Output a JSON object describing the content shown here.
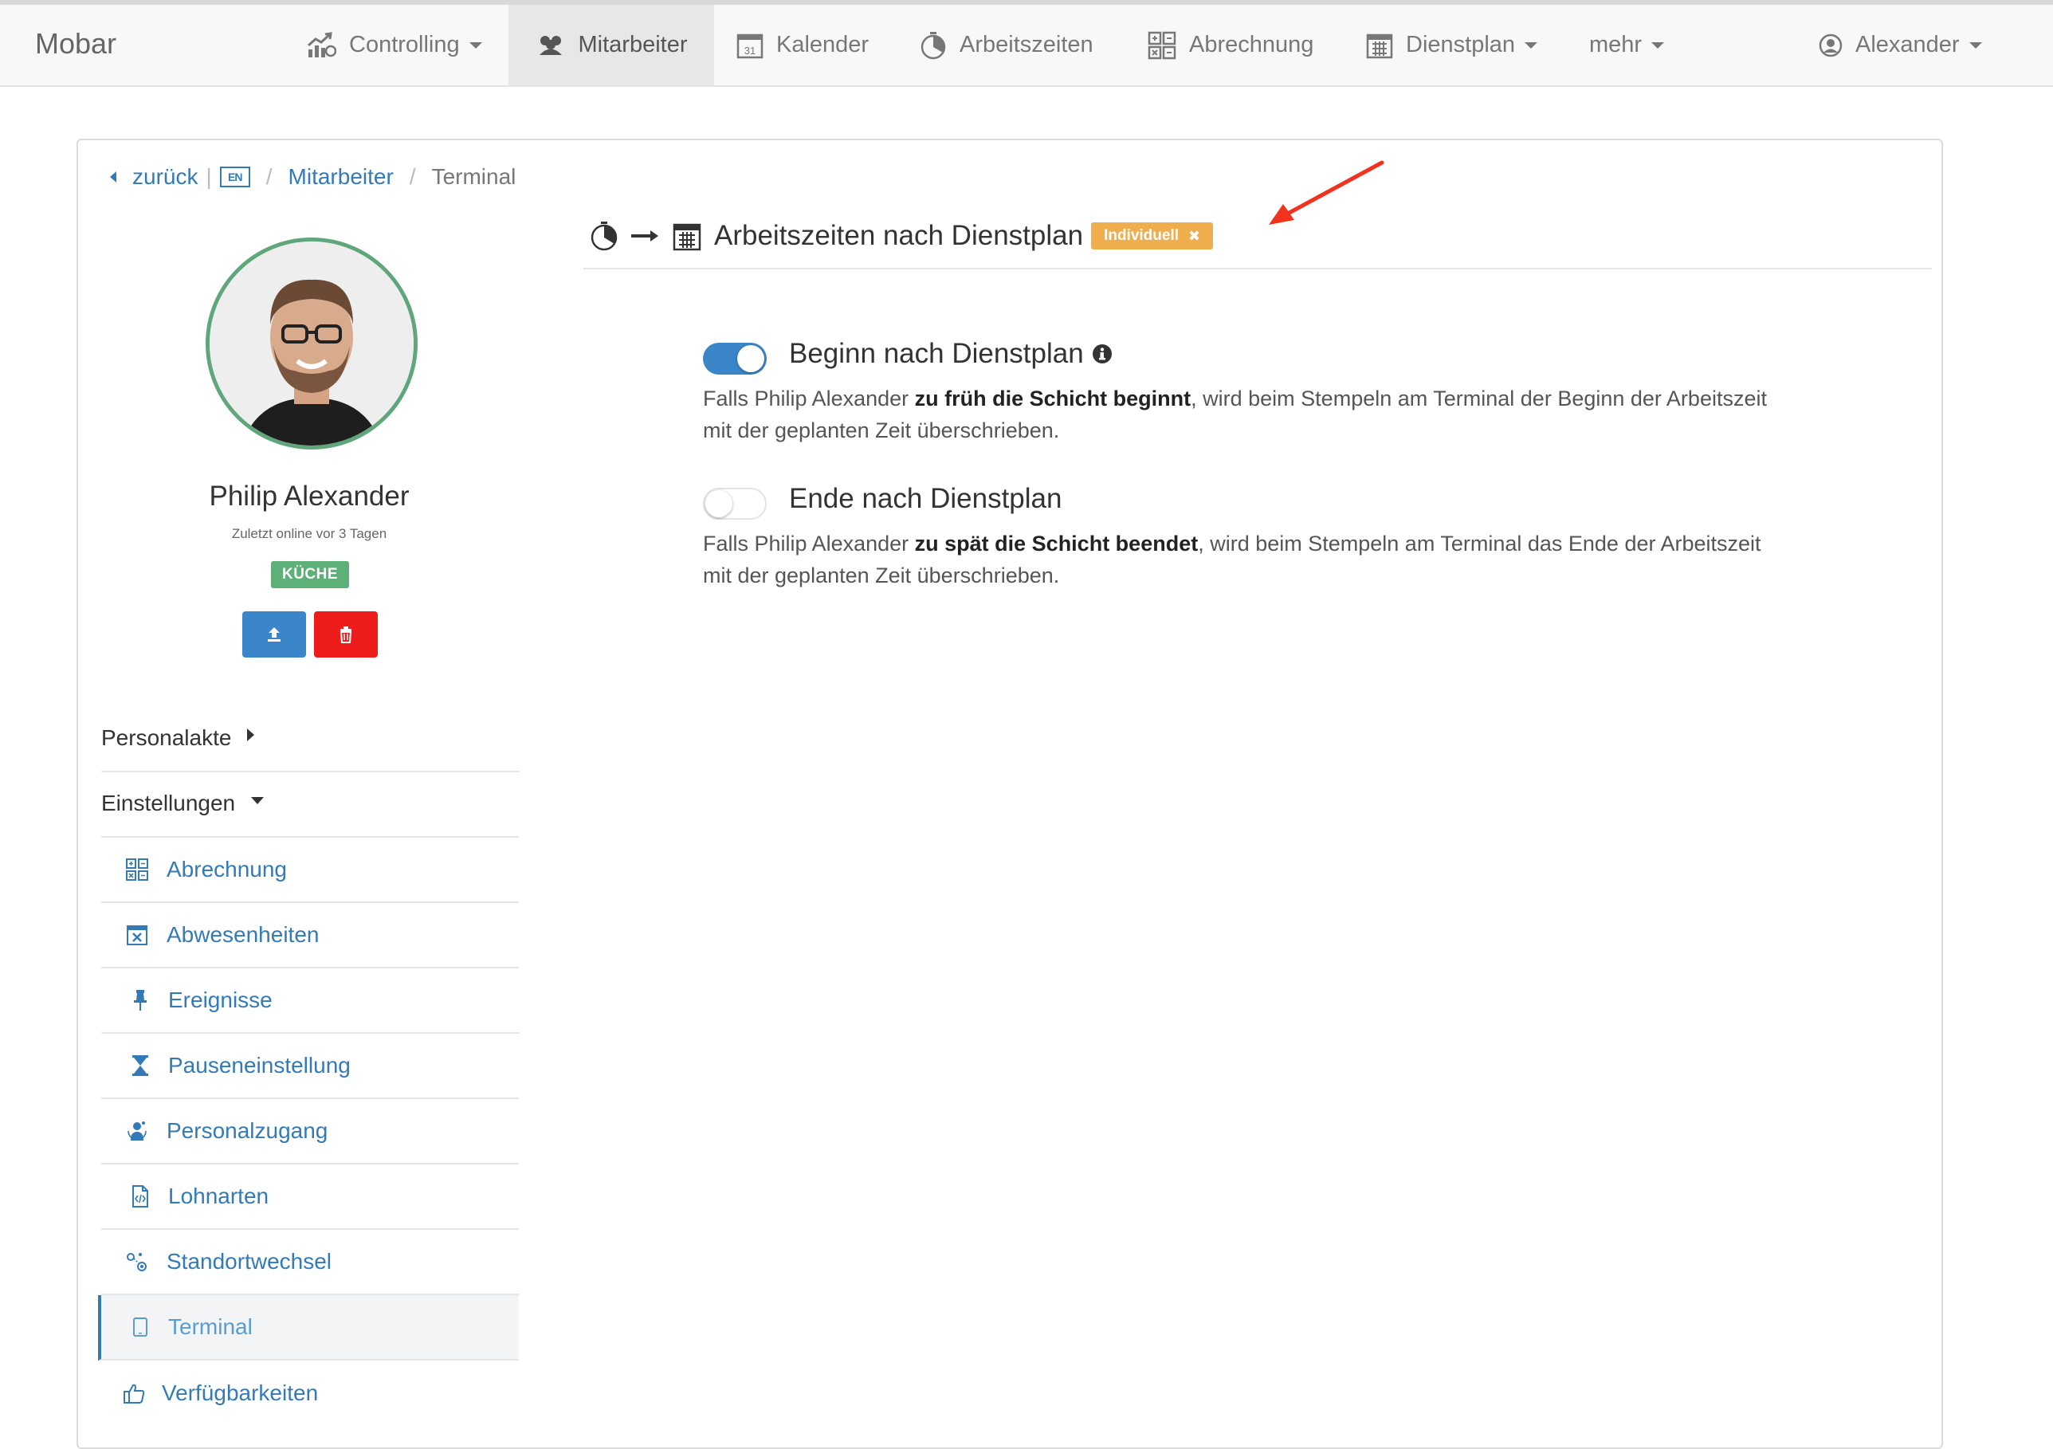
{
  "app": {
    "brand": "Mobar"
  },
  "nav": {
    "items": [
      {
        "label": "Controlling",
        "icon": "controlling-icon",
        "dropdown": true
      },
      {
        "label": "Mitarbeiter",
        "icon": "employees-icon",
        "active": true
      },
      {
        "label": "Kalender",
        "icon": "calendar-31-icon"
      },
      {
        "label": "Arbeitszeiten",
        "icon": "stopwatch-icon"
      },
      {
        "label": "Abrechnung",
        "icon": "accounting-icon"
      },
      {
        "label": "Dienstplan",
        "icon": "schedule-icon",
        "dropdown": true
      },
      {
        "label": "mehr",
        "dropdown": true
      }
    ],
    "user": {
      "label": "Alexander",
      "icon": "user-circle-icon"
    }
  },
  "breadcrumb": {
    "back": "zurück",
    "flag": "EN",
    "items": [
      "Mitarbeiter",
      "Terminal"
    ]
  },
  "profile": {
    "name": "Philip Alexander",
    "last_online": "Zuletzt online vor 3 Tagen",
    "department_badge": "KÜCHE",
    "upload_icon": "upload-icon",
    "delete_icon": "trash-icon"
  },
  "menu": {
    "personalakte": "Personalakte",
    "einstellungen": "Einstellungen",
    "items": [
      {
        "label": "Abrechnung",
        "icon": "accounting-icon"
      },
      {
        "label": "Abwesenheiten",
        "icon": "calendar-x-icon"
      },
      {
        "label": "Ereignisse",
        "icon": "pin-icon"
      },
      {
        "label": "Pauseneinstellung",
        "icon": "hourglass-icon"
      },
      {
        "label": "Personalzugang",
        "icon": "person-access-icon"
      },
      {
        "label": "Lohnarten",
        "icon": "document-code-icon"
      },
      {
        "label": "Standortwechsel",
        "icon": "location-change-icon"
      },
      {
        "label": "Terminal",
        "icon": "tablet-icon",
        "active": true
      },
      {
        "label": "Verfügbarkeiten",
        "icon": "thumbs-up-icon"
      }
    ]
  },
  "section": {
    "title": "Arbeitszeiten nach Dienstplan",
    "tag": "Individuell",
    "tag_close": "✖",
    "settings": [
      {
        "title": "Beginn nach Dienstplan",
        "enabled": true,
        "info": true,
        "desc_pre": "Falls Philip Alexander ",
        "desc_bold": "zu früh die Schicht beginnt",
        "desc_post": ", wird beim Stempeln am Terminal der Beginn der Arbeitszeit mit der geplanten Zeit überschrieben."
      },
      {
        "title": "Ende nach Dienstplan",
        "enabled": false,
        "info": false,
        "desc_pre": "Falls Philip Alexander ",
        "desc_bold": "zu spät die Schicht beendet",
        "desc_post": ", wird beim Stempeln am Terminal das Ende der Arbeitszeit mit der geplanten Zeit überschrieben."
      }
    ]
  },
  "colors": {
    "link": "#337ab7",
    "primary": "#3a86c8",
    "danger": "#ef1c1c",
    "success": "#5cb078",
    "warning": "#f0ad4e",
    "annotation_arrow": "#f0321e"
  }
}
